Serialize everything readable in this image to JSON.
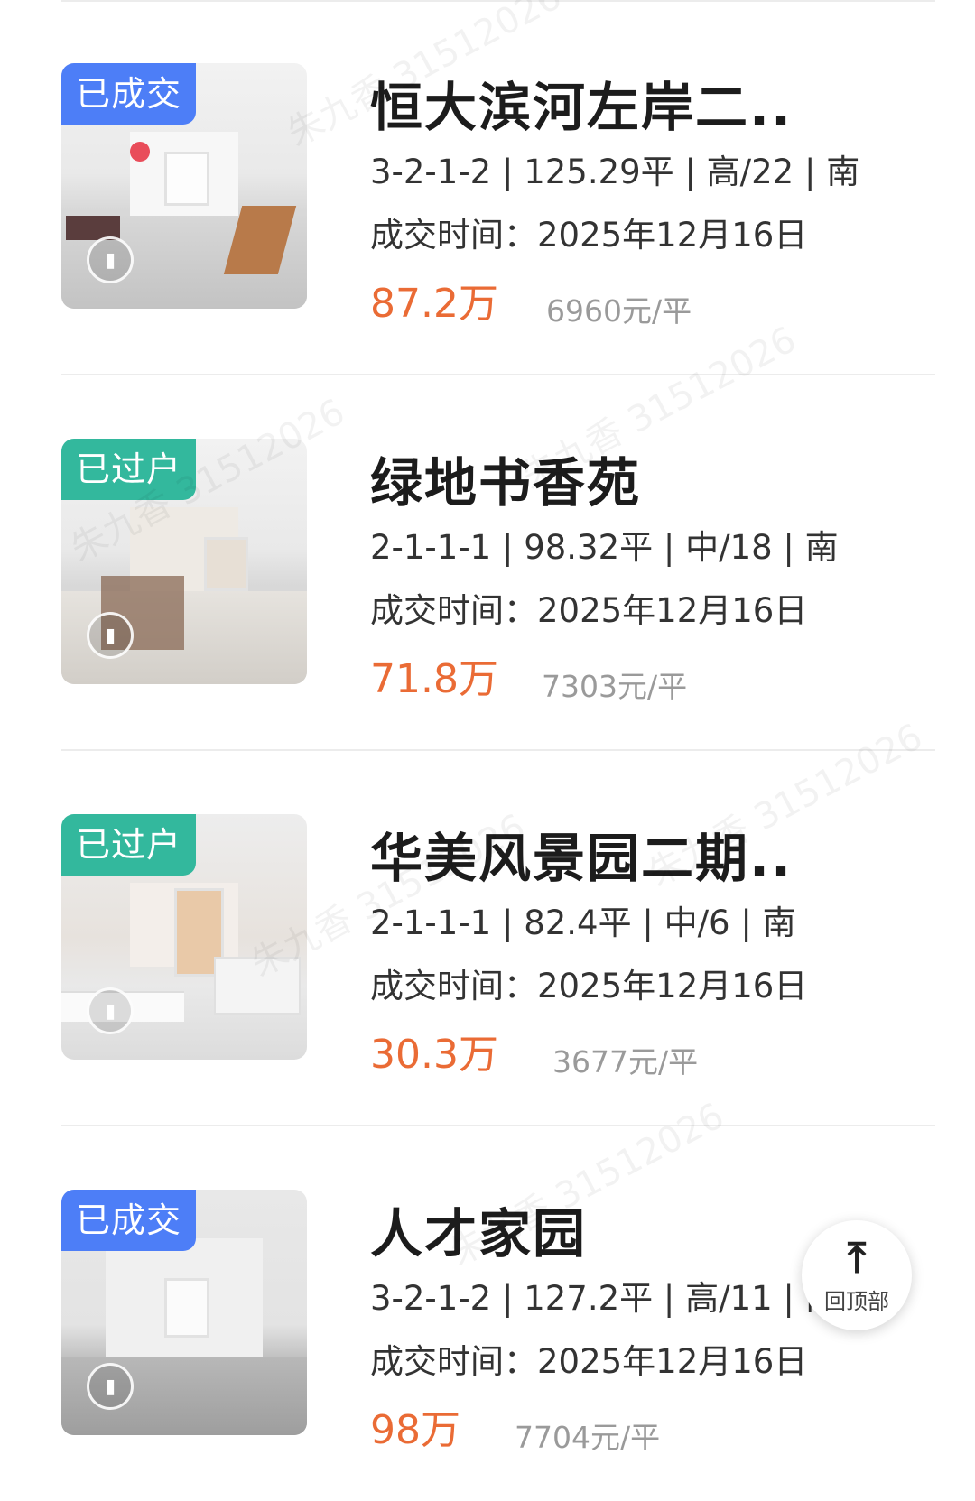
{
  "listings": [
    {
      "badge": "已成交",
      "title": "恒大滨河左岸二..",
      "specs": "3-2-1-2 | 125.29平 | 高/22 | 南",
      "deal_time": "成交时间：2025年12月16日",
      "price": "87.2万",
      "unit_price": "6960元/平"
    },
    {
      "badge": "已过户",
      "title": "绿地书香苑",
      "specs": "2-1-1-1 | 98.32平 | 中/18 | 南",
      "deal_time": "成交时间：2025年12月16日",
      "price": "71.8万",
      "unit_price": "7303元/平"
    },
    {
      "badge": "已过户",
      "title": "华美风景园二期..",
      "specs": "2-1-1-1 | 82.4平 | 中/6 | 南",
      "deal_time": "成交时间：2025年12月16日",
      "price": "30.3万",
      "unit_price": "3677元/平"
    },
    {
      "badge": "已成交",
      "title": "人才家园",
      "specs": "3-2-1-2 | 127.2平 | 高/11 | 南",
      "deal_time": "成交时间：2025年12月16日",
      "price": "98万",
      "unit_price": "7704元/平"
    }
  ],
  "back_to_top": {
    "label": "回顶部",
    "icon": "arrow-up-icon"
  },
  "watermark": "朱九香 31512026",
  "colors": {
    "price": "#ea6b35",
    "badge_blue": "#4d7ef7",
    "badge_teal": "#33b89d"
  }
}
